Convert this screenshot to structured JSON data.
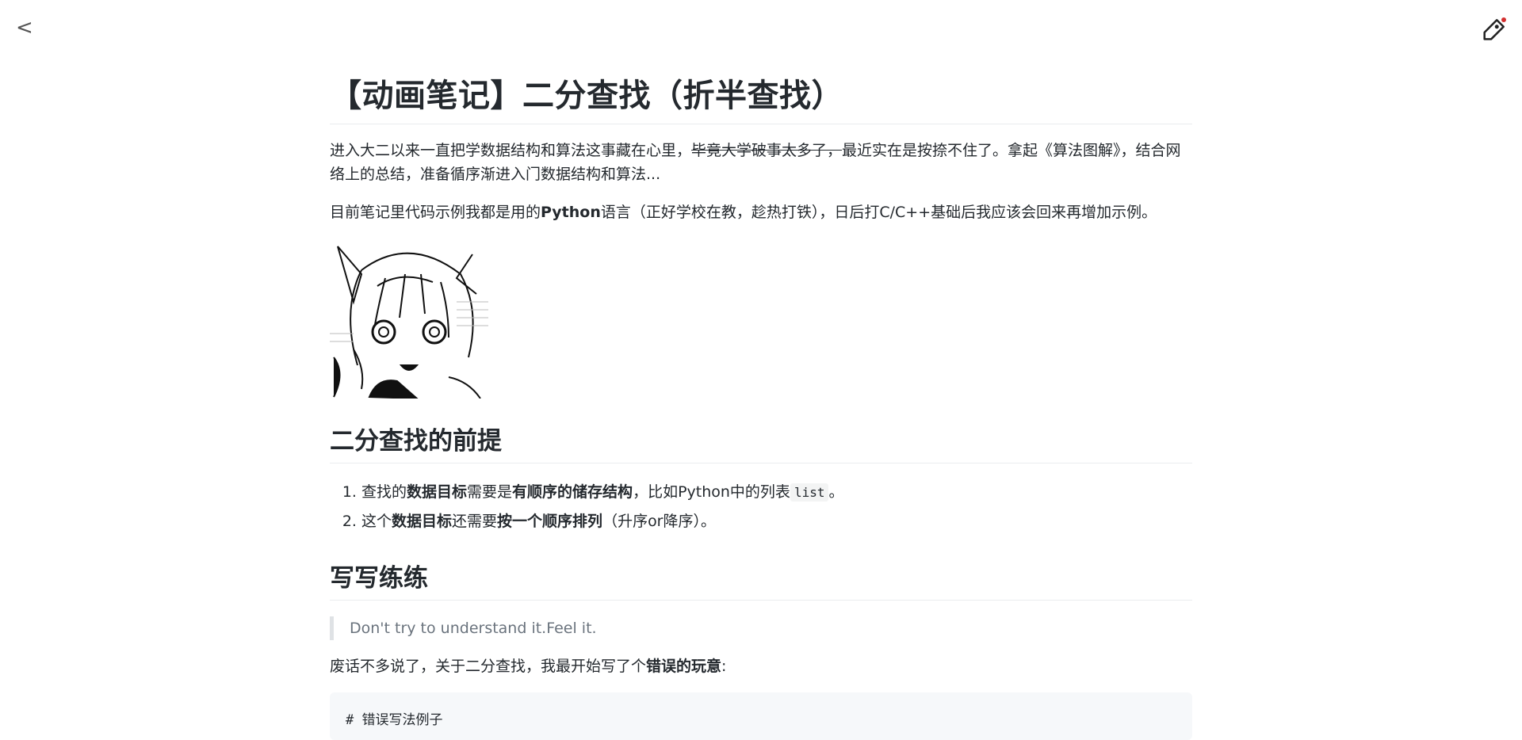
{
  "nav": {
    "back_label": "<",
    "tag_icon": "price-tag-icon"
  },
  "article": {
    "title": "【动画笔记】二分查找（折半查找）",
    "intro": {
      "part1": "进入大二以来一直把学数据结构和算法这事藏在心里，",
      "strike": "毕竟大学破事太多了，",
      "part2": "最近实在是按捺不住了。拿起《算法图解》，结合网络上的总结，准备循序渐进入门数据结构和算法..."
    },
    "lang_note": {
      "part1": "目前笔记里代码示例我都是用的",
      "bold": "Python",
      "part2": "语言（正好学校在教，趁热打铁），日后打C/C++基础后我应该会回来再增加示例。"
    },
    "section1": {
      "heading": "二分查找的前提",
      "items": [
        {
          "t1": "查找的",
          "b1": "数据目标",
          "t2": "需要是",
          "b2": "有顺序的储存结构",
          "t3": "，比如Python中的列表",
          "code": "list",
          "t4": "。"
        },
        {
          "t1": "这个",
          "b1": "数据目标",
          "t2": "还需要",
          "b2": "按一个顺序排列",
          "t3": "（升序or降序）。"
        }
      ]
    },
    "section2": {
      "heading": "写写练练",
      "quote": "Don't try to understand it.Feel it.",
      "para_text": "废话不多说了，关于二分查找，我最开始写了个",
      "para_bold": "错误的玩意",
      "para_end": ":",
      "code_first_line": "# 错误写法例子"
    }
  }
}
